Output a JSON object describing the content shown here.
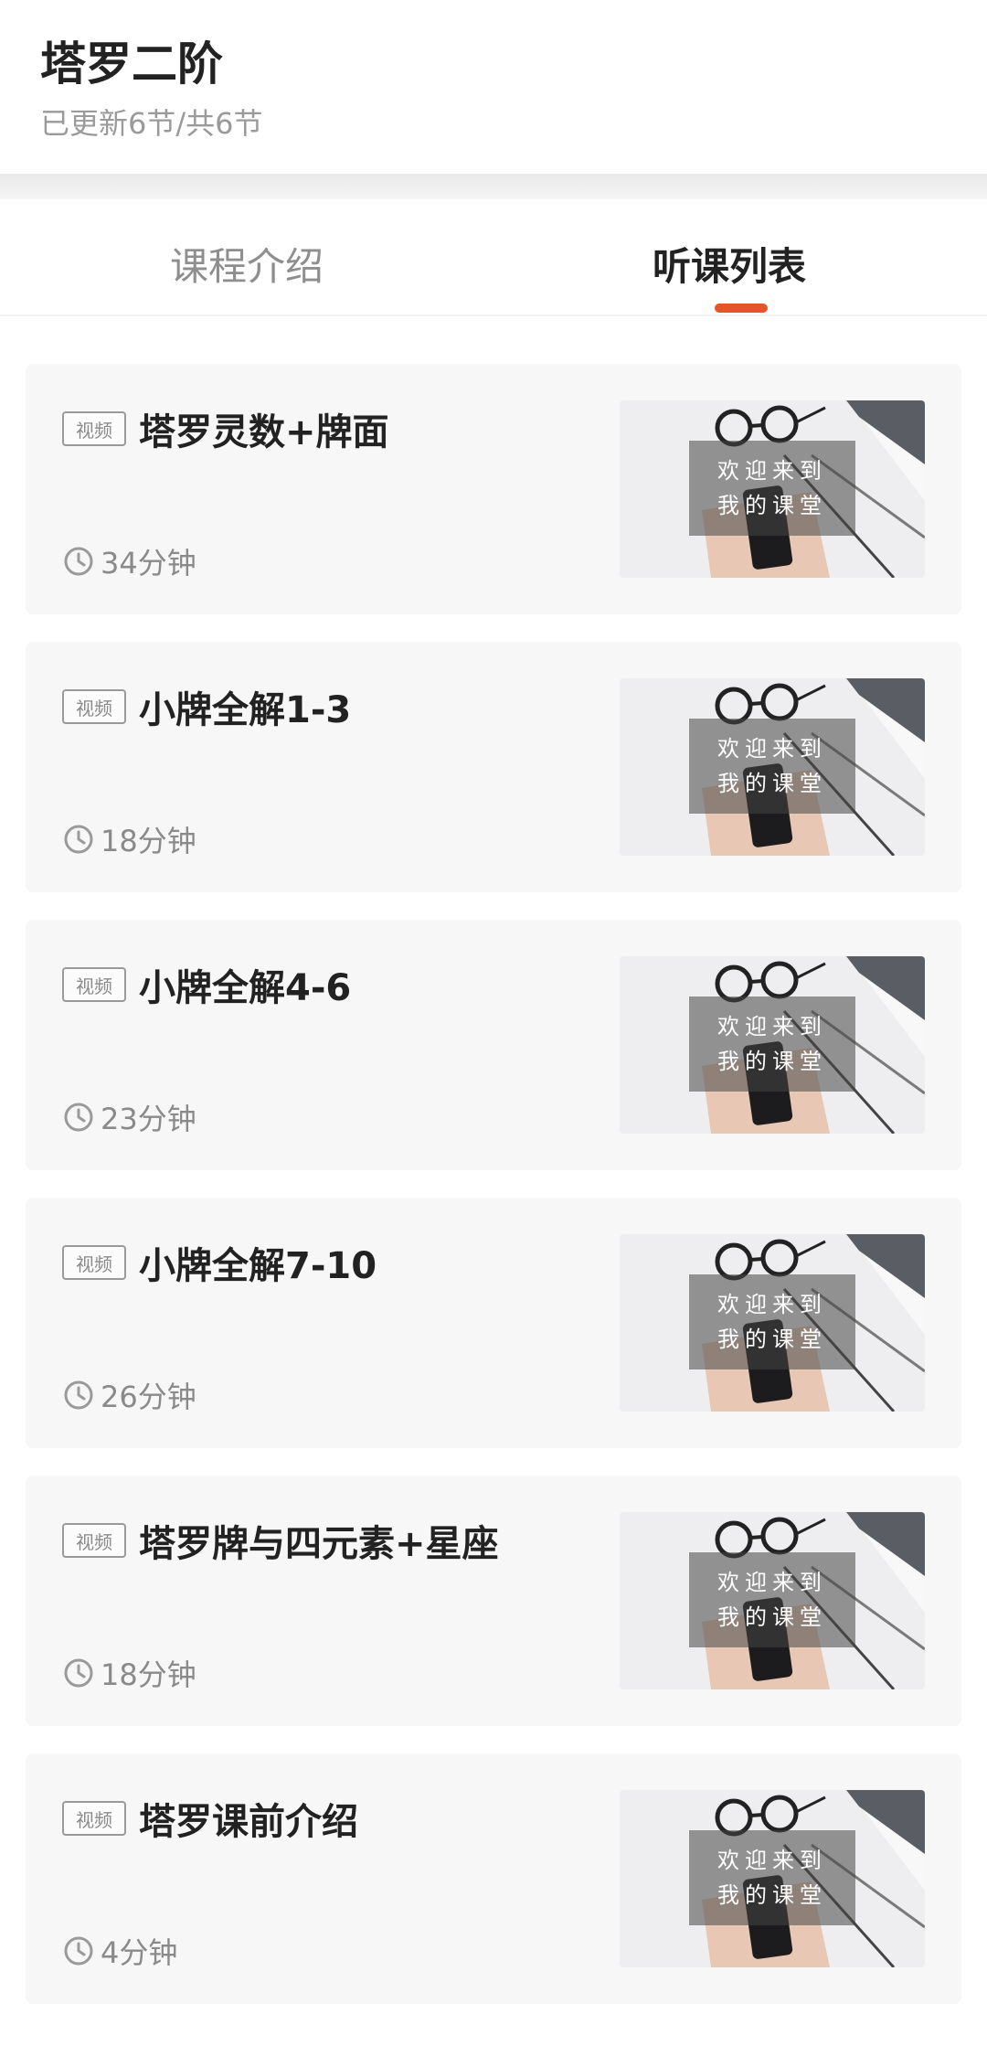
{
  "header": {
    "title": "塔罗二阶",
    "subtitle": "已更新6节/共6节"
  },
  "tabs": [
    {
      "label": "课程介绍",
      "active": false
    },
    {
      "label": "听课列表",
      "active": true
    }
  ],
  "accent_color": "#e8542a",
  "lessons": [
    {
      "badge": "视频",
      "title": "塔罗灵数+牌面",
      "duration": "34分钟",
      "thumb_line1": "欢迎来到",
      "thumb_line2": "我的课堂"
    },
    {
      "badge": "视频",
      "title": "小牌全解1-3",
      "duration": "18分钟",
      "thumb_line1": "欢迎来到",
      "thumb_line2": "我的课堂"
    },
    {
      "badge": "视频",
      "title": "小牌全解4-6",
      "duration": "23分钟",
      "thumb_line1": "欢迎来到",
      "thumb_line2": "我的课堂"
    },
    {
      "badge": "视频",
      "title": "小牌全解7-10",
      "duration": "26分钟",
      "thumb_line1": "欢迎来到",
      "thumb_line2": "我的课堂"
    },
    {
      "badge": "视频",
      "title": "塔罗牌与四元素+星座",
      "duration": "18分钟",
      "thumb_line1": "欢迎来到",
      "thumb_line2": "我的课堂"
    },
    {
      "badge": "视频",
      "title": "塔罗课前介绍",
      "duration": "4分钟",
      "thumb_line1": "欢迎来到",
      "thumb_line2": "我的课堂"
    }
  ]
}
